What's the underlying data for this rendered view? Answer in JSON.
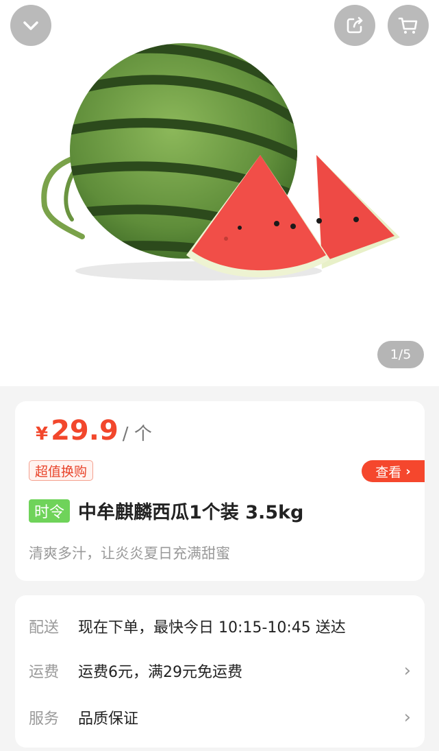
{
  "header": {
    "collapse_icon": "chevron-down-icon",
    "share_icon": "share-icon",
    "cart_icon": "cart-icon"
  },
  "gallery": {
    "indicator": "1/5"
  },
  "product": {
    "currency": "¥",
    "price": "29.9",
    "unit": "/ 个",
    "deal_tag": "超值换购",
    "view_button": "查看",
    "seasonal_badge": "时令",
    "title": "中牟麒麟西瓜1个装 3.5kg",
    "subtitle": "清爽多汁，让炎炎夏日充满甜蜜"
  },
  "info": {
    "delivery_label": "配送",
    "delivery_value": "现在下单，最快今日 10:15-10:45 送达",
    "shipping_label": "运费",
    "shipping_value": "运费6元，满29元免运费",
    "service_label": "服务",
    "service_value": "品质保证"
  },
  "colors": {
    "accent": "#f5472d",
    "seasonal": "#6fd35a"
  }
}
